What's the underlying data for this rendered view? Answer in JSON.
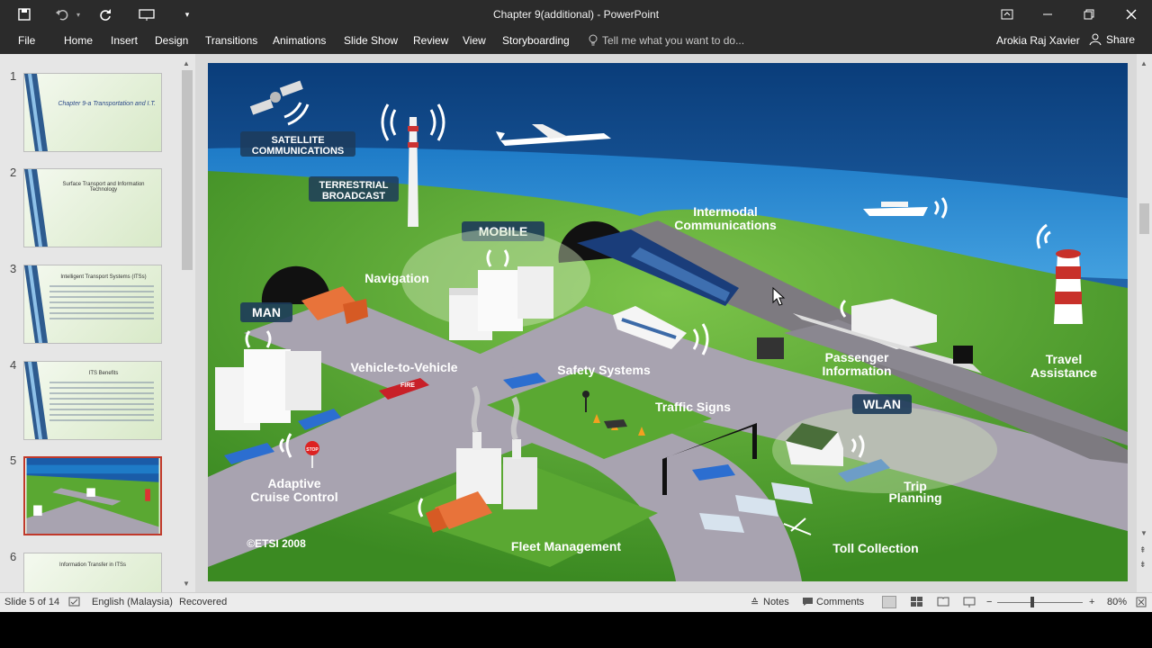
{
  "window": {
    "title": "Chapter 9(additional) - PowerPoint"
  },
  "ribbon": {
    "tabs": [
      "File",
      "Home",
      "Insert",
      "Design",
      "Transitions",
      "Animations",
      "Slide Show",
      "Review",
      "View",
      "Storyboarding"
    ],
    "tell_me": "Tell me what you want to do...",
    "user": "Arokia Raj Xavier",
    "share": "Share"
  },
  "thumbnails": [
    {
      "num": "1",
      "title": "Chapter 9-a Transportation and I.T."
    },
    {
      "num": "2",
      "title": "Surface Transport and Information Technology"
    },
    {
      "num": "3",
      "title": "Intelligent Transport Systems (ITSs)"
    },
    {
      "num": "4",
      "title": "ITS Benefits"
    },
    {
      "num": "5",
      "title": ""
    },
    {
      "num": "6",
      "title": "Information Transfer in ITSs"
    }
  ],
  "slide": {
    "labels": {
      "satellite": "SATELLITE",
      "communications": "COMMUNICATIONS",
      "terrestrial": "TERRESTRIAL",
      "broadcast": "BROADCAST",
      "mobile": "MOBILE",
      "man": "MAN",
      "navigation": "Navigation",
      "intermodal1": "Intermodal",
      "intermodal2": "Communications",
      "v2v": "Vehicle-to-Vehicle",
      "safety": "Safety Systems",
      "passenger1": "Passenger",
      "passenger2": "Information",
      "travel1": "Travel",
      "travel2": "Assistance",
      "wlan": "WLAN",
      "traffic_signs": "Traffic Signs",
      "adaptive1": "Adaptive",
      "adaptive2": "Cruise Control",
      "trip1": "Trip",
      "trip2": "Planning",
      "copyright": "©ETSI 2008",
      "fleet": "Fleet Management",
      "toll": "Toll Collection",
      "fire": "FIRE",
      "stop": "STOP"
    }
  },
  "status": {
    "slide": "Slide 5 of 14",
    "language": "English (Malaysia)",
    "recovered": "Recovered",
    "notes": "Notes",
    "comments": "Comments",
    "zoom": "80%"
  },
  "colors": {
    "sky_top": "#0a3d7a",
    "sea": "#1b6fb8",
    "grass": "#5aa832",
    "road": "#a8a3b0",
    "active_thumb": "#c0392b"
  }
}
